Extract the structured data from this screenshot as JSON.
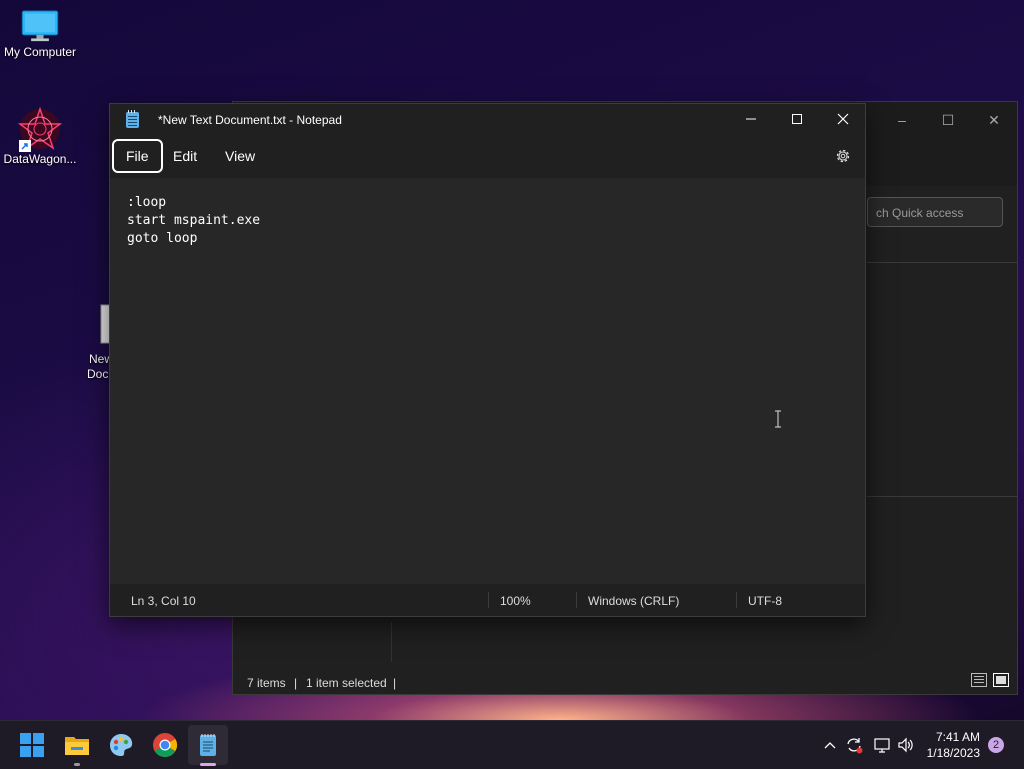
{
  "desktop": {
    "icons": [
      {
        "label": "My Computer"
      },
      {
        "label": "DataWagon..."
      },
      {
        "label": "New Docu"
      }
    ]
  },
  "explorer": {
    "search_placeholder": "ch Quick access",
    "status": {
      "items": "7 items",
      "selected": "1 item selected"
    }
  },
  "notepad": {
    "title": "*New Text Document.txt - Notepad",
    "menu": [
      "File",
      "Edit",
      "View"
    ],
    "content": ":loop\nstart mspaint.exe\ngoto loop",
    "status": {
      "position": "Ln 3, Col 10",
      "zoom": "100%",
      "line_ending": "Windows (CRLF)",
      "encoding": "UTF-8"
    }
  },
  "taskbar": {
    "apps": [
      "start-icon",
      "file-explorer-icon",
      "paint-icon",
      "chrome-icon",
      "notepad-icon"
    ],
    "clock": {
      "time": "7:41 AM",
      "date": "1/18/2023"
    },
    "notification_count": "2"
  },
  "colors": {
    "accent": "#5fb0e6",
    "taskbar_active": "#d9a9e6"
  }
}
